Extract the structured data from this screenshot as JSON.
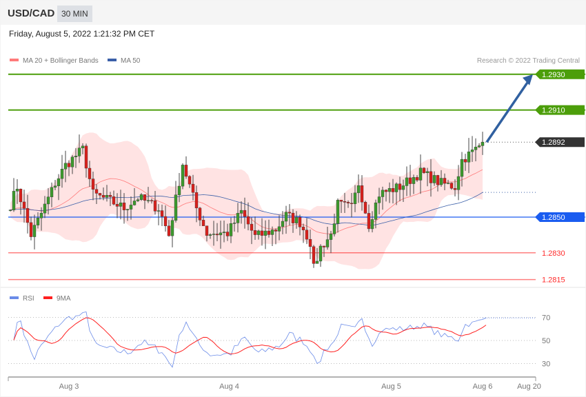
{
  "header": {
    "symbol": "USD/CAD",
    "timeframe": "30 MIN",
    "datetime": "Friday, August 5, 2022 1:21:32 PM CET"
  },
  "legend": {
    "ma20": "MA 20 + Bollinger Bands",
    "ma50": "MA 50",
    "rsi": "RSI",
    "rsi_ma": "9MA",
    "copyright": "Research © 2022 Trading Central"
  },
  "colors": {
    "resistance": "#4c9e0a",
    "current": "#333333",
    "pivot": "#1a5cf0",
    "support": "#ff2a2a",
    "band": "#ffe0e0",
    "ma20": "#ff7a7a",
    "ma50": "#3a5fa8",
    "rsi": "#6a8be8",
    "rsi_ma": "#ff2020"
  },
  "chart_data": {
    "type": "candlestick",
    "title": "USD/CAD 30 MIN",
    "levels": [
      {
        "label": "1.2930",
        "value": 1.293,
        "kind": "resistance"
      },
      {
        "label": "1.2910",
        "value": 1.291,
        "kind": "resistance"
      },
      {
        "label": "1.2892",
        "value": 1.2892,
        "kind": "current"
      },
      {
        "label": "1.2850",
        "value": 1.285,
        "kind": "pivot"
      },
      {
        "label": "1.2830",
        "value": 1.283,
        "kind": "support"
      },
      {
        "label": "1.2815",
        "value": 1.2815,
        "kind": "support"
      }
    ],
    "price_keypoints": [
      [
        0,
        1.2857
      ],
      [
        2,
        1.2867
      ],
      [
        6,
        1.284
      ],
      [
        9,
        1.2852
      ],
      [
        13,
        1.2869
      ],
      [
        16,
        1.2879
      ],
      [
        21,
        1.2888
      ],
      [
        24,
        1.2863
      ],
      [
        29,
        1.2859
      ],
      [
        33,
        1.2855
      ],
      [
        37,
        1.2861
      ],
      [
        43,
        1.2855
      ],
      [
        46,
        1.284
      ],
      [
        50,
        1.288
      ],
      [
        54,
        1.2855
      ],
      [
        57,
        1.2841
      ],
      [
        63,
        1.2841
      ],
      [
        67,
        1.2853
      ],
      [
        71,
        1.2839
      ],
      [
        77,
        1.2843
      ],
      [
        80,
        1.2851
      ],
      [
        84,
        1.2847
      ],
      [
        87,
        1.2836
      ],
      [
        88,
        1.2821
      ],
      [
        90,
        1.2833
      ],
      [
        93,
        1.284
      ],
      [
        95,
        1.2857
      ],
      [
        99,
        1.2855
      ],
      [
        101,
        1.2869
      ],
      [
        104,
        1.2846
      ],
      [
        107,
        1.2863
      ],
      [
        113,
        1.2867
      ],
      [
        119,
        1.2875
      ],
      [
        125,
        1.2869
      ],
      [
        129,
        1.2867
      ],
      [
        131,
        1.2882
      ],
      [
        135,
        1.2888
      ],
      [
        137,
        1.2892
      ]
    ],
    "x_ticks": [
      {
        "label": "Aug 3",
        "index": 18
      },
      {
        "label": "Aug 4",
        "index": 64.5
      },
      {
        "label": "Aug 5",
        "index": 111.5
      },
      {
        "label": "Aug 6",
        "index": 138
      },
      {
        "label": "Aug 20",
        "index": 151.5
      }
    ],
    "rsi": {
      "ticks": [
        {
          "label": "70",
          "value": 70
        },
        {
          "label": "50",
          "value": 50
        },
        {
          "label": "30",
          "value": 30
        }
      ],
      "period": 14,
      "ma_period": 9
    },
    "forecast": {
      "direction": "up",
      "target": 1.293
    }
  }
}
